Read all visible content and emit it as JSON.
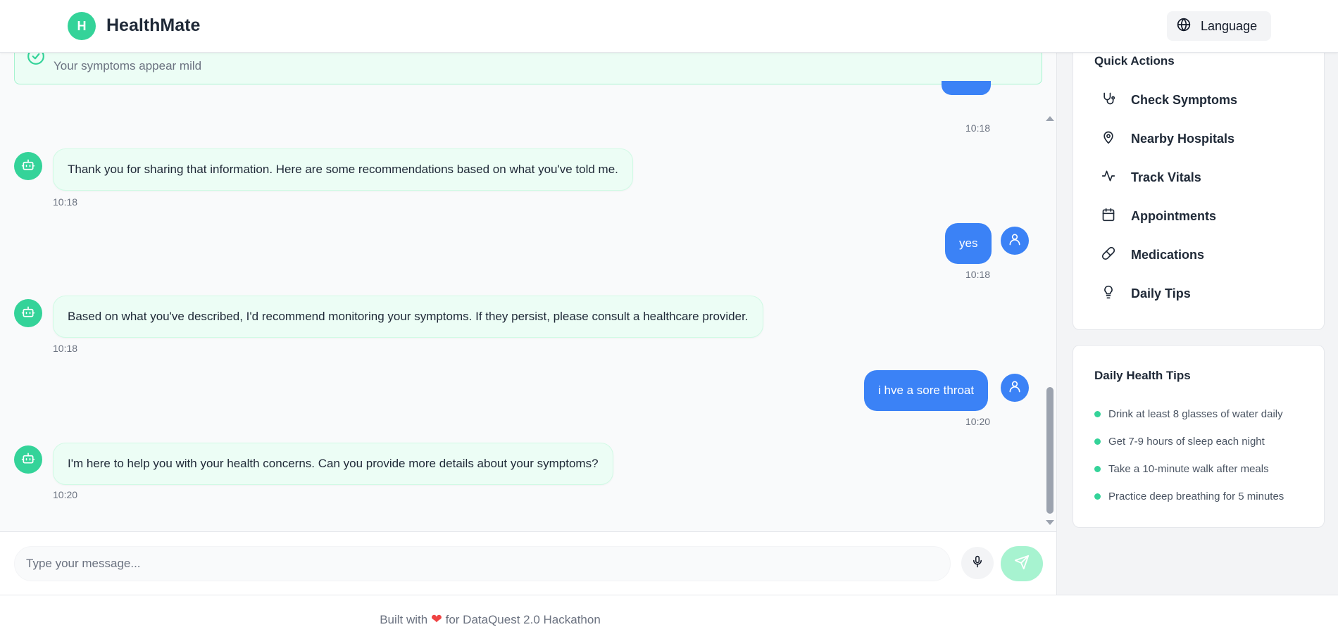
{
  "header": {
    "logo_letter": "H",
    "title": "HealthMate",
    "language_label": "Language"
  },
  "alert": {
    "text": "Your symptoms appear mild"
  },
  "messages": [
    {
      "sender": "user",
      "text": "",
      "time": "10:18"
    },
    {
      "sender": "bot",
      "text": "Thank you for sharing that information. Here are some recommendations based on what you've told me.",
      "time": "10:18"
    },
    {
      "sender": "user",
      "text": "yes",
      "time": "10:18"
    },
    {
      "sender": "bot",
      "text": "Based on what you've described, I'd recommend monitoring your symptoms. If they persist, please consult a healthcare provider.",
      "time": "10:18"
    },
    {
      "sender": "user",
      "text": "i hve a sore throat",
      "time": "10:20"
    },
    {
      "sender": "bot",
      "text": "I'm here to help you with your health concerns. Can you provide more details about your symptoms?",
      "time": "10:20"
    }
  ],
  "input": {
    "placeholder": "Type your message..."
  },
  "footer": {
    "prefix": "Built with",
    "heart": "❤",
    "suffix": "for DataQuest 2.0 Hackathon"
  },
  "quick_actions": {
    "title": "Quick Actions",
    "items": [
      {
        "label": "Check Symptoms",
        "icon": "stethoscope-icon"
      },
      {
        "label": "Nearby Hospitals",
        "icon": "map-pin-icon"
      },
      {
        "label": "Track Vitals",
        "icon": "activity-icon"
      },
      {
        "label": "Appointments",
        "icon": "calendar-icon"
      },
      {
        "label": "Medications",
        "icon": "pill-icon"
      },
      {
        "label": "Daily Tips",
        "icon": "lightbulb-icon"
      }
    ]
  },
  "daily_tips": {
    "title": "Daily Health Tips",
    "items": [
      "Drink at least 8 glasses of water daily",
      "Get 7-9 hours of sleep each night",
      "Take a 10-minute walk after meals",
      "Practice deep breathing for 5 minutes"
    ]
  },
  "colors": {
    "brand_green": "#34d399",
    "user_blue": "#3b82f6",
    "bot_bubble": "#ecfdf5",
    "heart_red": "#ef4444"
  }
}
